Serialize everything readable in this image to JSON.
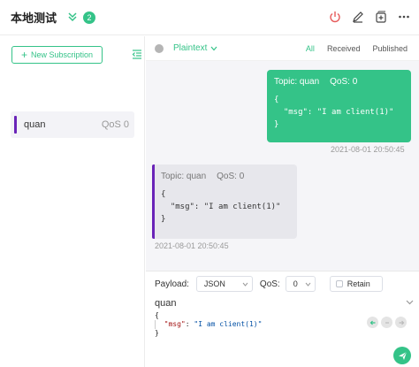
{
  "header": {
    "connection_name": "本地测试",
    "badge_count": "2",
    "icons": [
      "power-icon",
      "edit-icon",
      "new-window-icon",
      "more-icon"
    ],
    "colors": {
      "accent": "#34c388",
      "power": "#e65a5a"
    }
  },
  "sidebar": {
    "new_subscription_label": "New Subscription",
    "subscriptions": [
      {
        "topic": "quan",
        "qos": "QoS 0",
        "color": "#6a24b8"
      }
    ]
  },
  "toolbar": {
    "format": "Plaintext",
    "filters": [
      "All",
      "Received",
      "Published"
    ],
    "active_filter": "All"
  },
  "messages": [
    {
      "direction": "out",
      "topic_label": "Topic: quan",
      "qos_label": "QoS: 0",
      "payload_lines": [
        "{",
        "  \"msg\": \"I am client(1)\"",
        "}"
      ],
      "time": "2021-08-01 20:50:45"
    },
    {
      "direction": "in",
      "topic_label": "Topic: quan",
      "qos_label": "QoS: 0",
      "payload_lines": [
        "{",
        "  \"msg\": \"I am client(1)\"",
        "}"
      ],
      "time": "2021-08-01 20:50:45"
    }
  ],
  "publish": {
    "payload_label": "Payload:",
    "payload_format": "JSON",
    "qos_label": "QoS:",
    "qos_value": "0",
    "retain_label": "Retain",
    "topic": "quan",
    "payload_open": "{",
    "payload_key": "\"msg\"",
    "payload_sep": ": ",
    "payload_value": "\"I am client(1)\"",
    "payload_close": "}"
  }
}
